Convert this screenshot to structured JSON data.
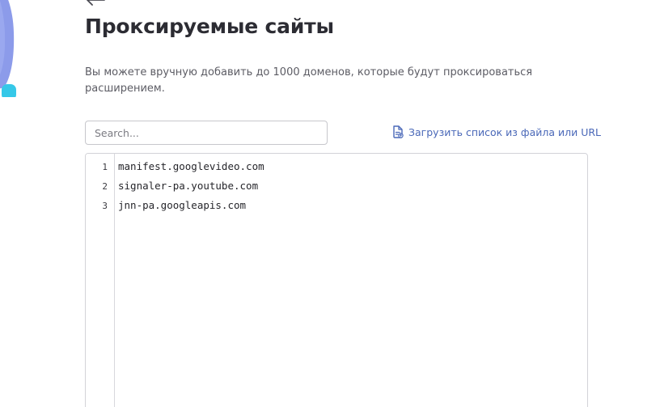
{
  "header": {
    "back_icon": "arrow-left-icon",
    "title": "Проксируемые сайты"
  },
  "description": "Вы можете вручную добавить до 1000 доменов, которые будут проксироваться расширением.",
  "search": {
    "placeholder": "Search...",
    "value": ""
  },
  "upload": {
    "icon": "file-upload-icon",
    "label": "Загрузить список из файла или URL"
  },
  "editor": {
    "lines": [
      {
        "number": "1",
        "text": "manifest.googlevideo.com"
      },
      {
        "number": "2",
        "text": "signaler-pa.youtube.com"
      },
      {
        "number": "3",
        "text": "jnn-pa.googleapis.com"
      }
    ]
  },
  "colors": {
    "link": "#4a68b8",
    "mascot_body": "#8c9bea",
    "mascot_accent": "#35c8e8",
    "border": "#c7c7cc"
  }
}
